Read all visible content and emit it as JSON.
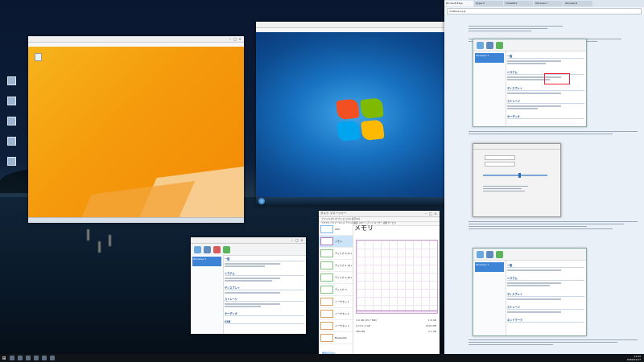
{
  "browser": {
    "tabs": [
      "Microsoft Edge",
      "Hyper-V",
      "VirtualBox",
      "Windows 7",
      "Windows 8"
    ],
    "url": "d.hatena.ne.jp"
  },
  "vbox_manager": {
    "vm_name": "Windows 7",
    "section_general": "一般",
    "section_system": "システム",
    "section_display": "ディスプレイ",
    "section_storage": "ストレージ",
    "section_audio": "オーディオ",
    "section_network": "ネットワーク",
    "section_usb": "USB"
  },
  "task_manager": {
    "title": "タスク マネージャー",
    "menu": "ファイル(F)  オプション(O)  表示(V)",
    "tabs": "プロセス  パフォーマンス  アプリの履歴  スタートアップ  ユーザー  詳細  サービス",
    "heading": "メモリ",
    "items": [
      "CPU",
      "メモリ",
      "ディスク 0 (C:)",
      "ディスク 1 (D:)",
      "ディスク 2 (E:)",
      "ディスク 3",
      "イーサネット",
      "イーサネット",
      "イーサネット",
      "Bluetooth",
      "Wi-Fi"
    ],
    "stats": [
      "4.9 GB (95.7 MB)",
      "1.8 GB",
      "9.7/11.1 GB",
      "1603 MB",
      "380 MB",
      "2.1 GB"
    ],
    "footer": "簡易表示(D)",
    "memory_usage": 0.02
  },
  "taskbar": {
    "time": "11:32",
    "date": "2016/01/17"
  }
}
